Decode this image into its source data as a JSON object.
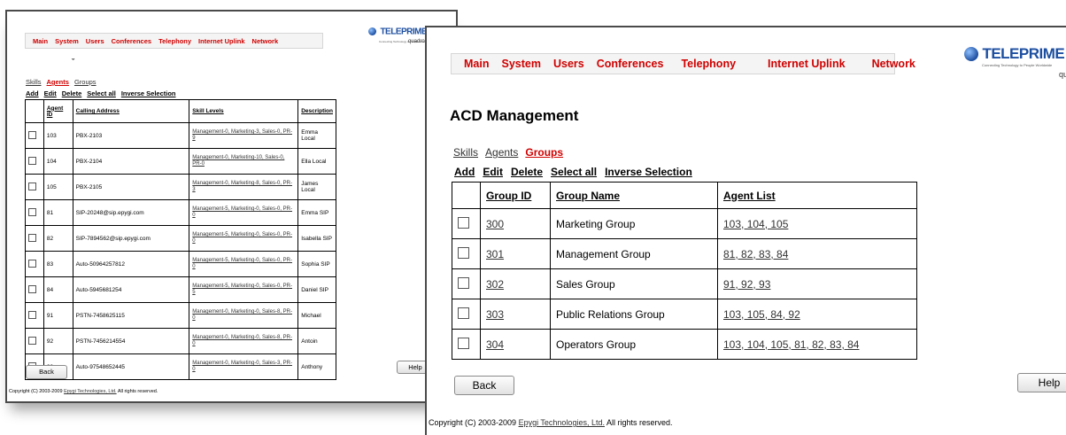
{
  "nav": [
    "Main",
    "System",
    "Users",
    "Conferences",
    "Telephony",
    "Internet Uplink",
    "Network"
  ],
  "logo": {
    "word": "TELEPRIME",
    "tagline": "Connecting Technology to People Worldwide",
    "brand_suffix": "quadrom"
  },
  "back_window": {
    "title_fragment": "ˇ",
    "subnav": [
      "Skills",
      "Agents",
      "Groups"
    ],
    "actions": [
      "Add",
      "Edit",
      "Delete",
      "Select all",
      "Inverse Selection"
    ],
    "columns": [
      "Agent ID",
      "Calling Address",
      "Skill Levels",
      "Description"
    ],
    "rows": [
      {
        "id": "103",
        "address": "PBX-2103",
        "skills": "Management-0, Marketing-3, Sales-0, PR-9",
        "desc": "Emma Local"
      },
      {
        "id": "104",
        "address": "PBX-2104",
        "skills": "Management-0, Marketing-10, Sales-0, PR-0",
        "desc": "Ella Local"
      },
      {
        "id": "105",
        "address": "PBX-2105",
        "skills": "Management-0, Marketing-8, Sales-0, PR-3",
        "desc": "James Local"
      },
      {
        "id": "81",
        "address": "SIP-20248@sip.epygi.com",
        "skills": "Management-5, Marketing-0, Sales-0, PR-0",
        "desc": "Emma SIP"
      },
      {
        "id": "82",
        "address": "SIP-7894562@sip.epygi.com",
        "skills": "Management-5, Marketing-0, Sales-0, PR-0",
        "desc": "Isabella SIP"
      },
      {
        "id": "83",
        "address": "Auto-50964257812",
        "skills": "Management-5, Marketing-0, Sales-0, PR-0",
        "desc": "Sophia SIP"
      },
      {
        "id": "84",
        "address": "Auto-5945681254",
        "skills": "Management-5, Marketing-0, Sales-0, PR-5",
        "desc": "Daniel SIP"
      },
      {
        "id": "91",
        "address": "PSTN-7458625115",
        "skills": "Management-0, Marketing-0, Sales-8, PR-0",
        "desc": "Michael"
      },
      {
        "id": "92",
        "address": "PSTN-7456214554",
        "skills": "Management-0, Marketing-0, Sales-8, PR-0",
        "desc": "Antoin"
      },
      {
        "id": "93",
        "address": "Auto-97548652445",
        "skills": "Management-0, Marketing-0, Sales-3, PR-0",
        "desc": "Anthony"
      }
    ],
    "back_label": "Back",
    "help_label": "Help",
    "footer_prefix": "Copyright (C) 2003-2009 ",
    "footer_link": "Epygi Technologies, Ltd.",
    "footer_suffix": " All rights reserved."
  },
  "front_window": {
    "title": "ACD Management",
    "subnav": [
      "Skills",
      "Agents",
      "Groups"
    ],
    "actions": [
      "Add",
      "Edit",
      "Delete",
      "Select all",
      "Inverse Selection"
    ],
    "columns": [
      "Group ID",
      "Group Name",
      "Agent List"
    ],
    "rows": [
      {
        "id": "300",
        "name": "Marketing Group",
        "agents": "103, 104, 105"
      },
      {
        "id": "301",
        "name": "Management Group",
        "agents": "81, 82, 83, 84"
      },
      {
        "id": "302",
        "name": "Sales Group",
        "agents": "91, 92, 93"
      },
      {
        "id": "303",
        "name": "Public Relations Group",
        "agents": "103, 105, 84, 92"
      },
      {
        "id": "304",
        "name": "Operators Group",
        "agents": "103, 104, 105, 81, 82, 83, 84"
      }
    ],
    "back_label": "Back",
    "help_label": "Help",
    "footer_prefix": "Copyright (C) 2003-2009 ",
    "footer_link": "Epygi Technologies, Ltd.",
    "footer_suffix": " All rights reserved."
  }
}
